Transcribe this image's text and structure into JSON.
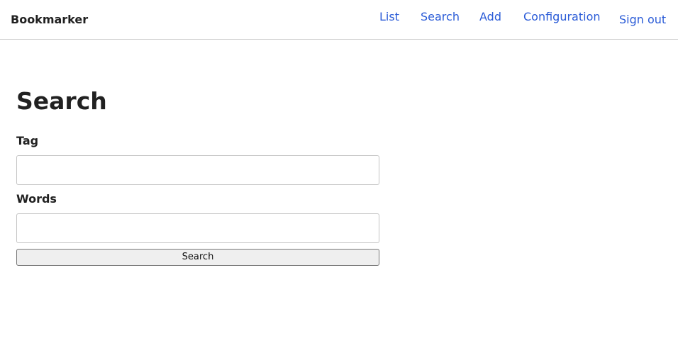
{
  "header": {
    "brand": "Bookmarker",
    "nav": {
      "list": "List",
      "search": "Search",
      "add": "Add",
      "configuration": "Configuration",
      "sign_out": "Sign out"
    }
  },
  "main": {
    "title": "Search",
    "form": {
      "tag_label": "Tag",
      "tag_value": "",
      "tag_placeholder": "",
      "words_label": "Words",
      "words_value": "",
      "words_placeholder": "",
      "submit_label": "Search"
    }
  },
  "colors": {
    "link": "#2a5bd7",
    "text": "#212121",
    "border": "#d0d0d0",
    "button_bg": "#efefef"
  }
}
